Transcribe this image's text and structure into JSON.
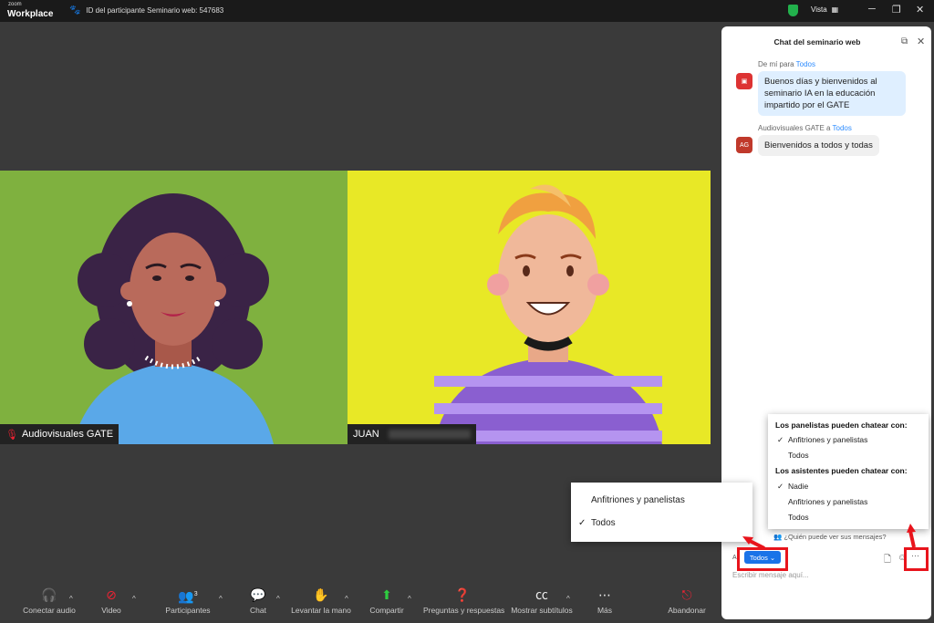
{
  "titlebar": {
    "logo_top": "zoom",
    "logo_bottom": "Workplace",
    "meeting_id": "ID del participante Seminario web: 547683",
    "view_label": "Vista"
  },
  "videos": {
    "left_name": "Audiovisuales GATE",
    "right_name": "JUAN"
  },
  "chat": {
    "title": "Chat del seminario web",
    "messages": [
      {
        "meta_from": "De mí para",
        "meta_to": "Todos",
        "text": "Buenos días y bienvenidos al seminario IA en la educación impartido por el GATE"
      },
      {
        "meta_from": "Audiovisuales GATE a",
        "meta_to": "Todos",
        "avatar": "AG",
        "text": "Bienvenidos a todos y todas"
      }
    ],
    "who_sees": "¿Quién puede ver sus mensajes?",
    "to_label": "A:",
    "to_button": "Todos",
    "input_placeholder": "Escribir mensaje aquí..."
  },
  "permissions_menu": {
    "panelists_header": "Los panelistas pueden chatear con:",
    "panelists_opts": [
      "Anfitriones y panelistas",
      "Todos"
    ],
    "attendees_header": "Los asistentes pueden chatear con:",
    "attendees_opts": [
      "Nadie",
      "Anfitriones y panelistas",
      "Todos"
    ]
  },
  "recipient_menu": {
    "opts": [
      "Anfitriones y panelistas",
      "Todos"
    ]
  },
  "toolbar": {
    "audio": "Conectar audio",
    "video": "Video",
    "participants": "Participantes",
    "participants_count": "3",
    "chat": "Chat",
    "raise_hand": "Levantar la mano",
    "share": "Compartir",
    "qa": "Preguntas y respuestas",
    "subtitles": "Mostrar subtítulos",
    "more": "Más",
    "leave": "Abandonar"
  },
  "colors": {
    "highlight": "#e8141c",
    "accent": "#1a73e8",
    "left_tile_bg": "#7fb13f",
    "right_tile_bg": "#e8e826"
  }
}
